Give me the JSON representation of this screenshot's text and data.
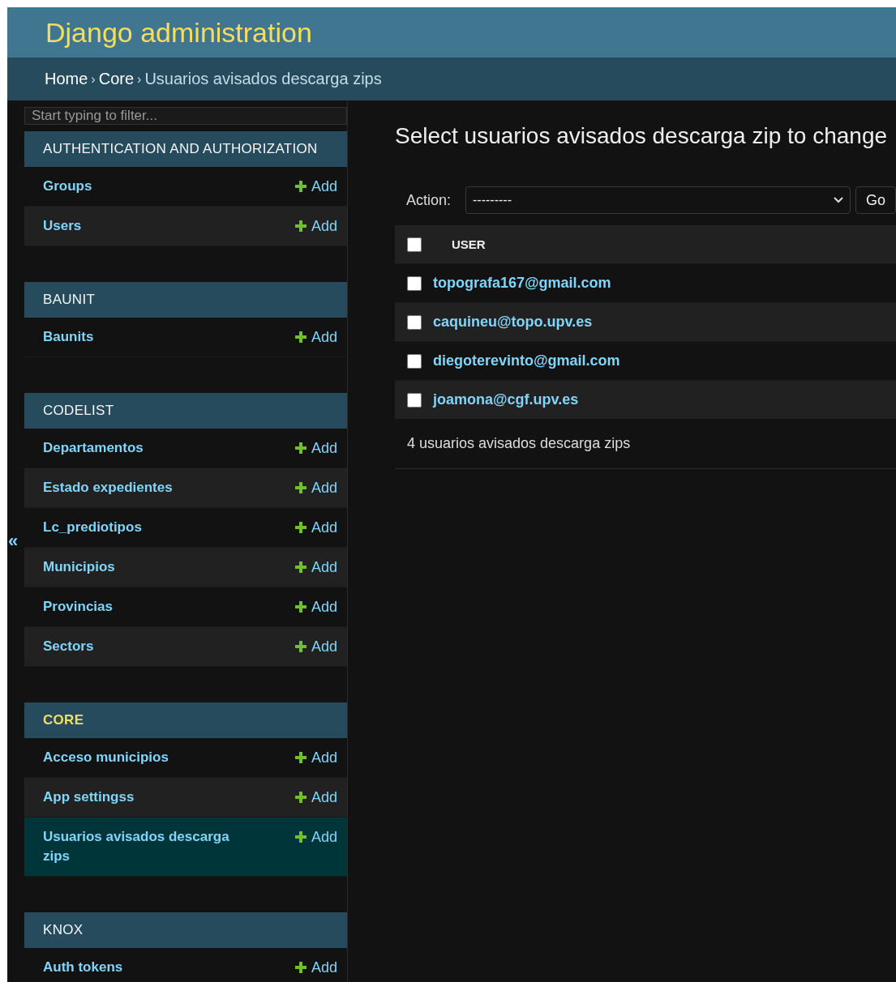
{
  "header": {
    "title": "Django administration"
  },
  "breadcrumbs": [
    {
      "label": "Home",
      "link": true
    },
    {
      "label": "Core",
      "link": true
    },
    {
      "label": "Usuarios avisados descarga zips",
      "link": false
    }
  ],
  "breadcrumb_separator": "›",
  "sidebar": {
    "filter": {
      "placeholder": "Start typing to filter..."
    },
    "toggle": "«",
    "modules": [
      {
        "name": "AUTHENTICATION AND AUTHORIZATION",
        "current": false,
        "models": [
          {
            "name": "Groups",
            "add": "Add",
            "selected": false
          },
          {
            "name": "Users",
            "add": "Add",
            "selected": false
          }
        ]
      },
      {
        "name": "BAUNIT",
        "current": false,
        "models": [
          {
            "name": "Baunits",
            "add": "Add",
            "selected": false
          }
        ]
      },
      {
        "name": "CODELIST",
        "current": false,
        "models": [
          {
            "name": "Departamentos",
            "add": "Add",
            "selected": false
          },
          {
            "name": "Estado expedientes",
            "add": "Add",
            "selected": false
          },
          {
            "name": "Lc_prediotipos",
            "add": "Add",
            "selected": false
          },
          {
            "name": "Municipios",
            "add": "Add",
            "selected": false
          },
          {
            "name": "Provincias",
            "add": "Add",
            "selected": false
          },
          {
            "name": "Sectors",
            "add": "Add",
            "selected": false
          }
        ]
      },
      {
        "name": "CORE",
        "current": true,
        "models": [
          {
            "name": "Acceso municipios",
            "add": "Add",
            "selected": false
          },
          {
            "name": "App settingss",
            "add": "Add",
            "selected": false
          },
          {
            "name": "Usuarios avisados descarga zips",
            "add": "Add",
            "selected": true
          }
        ]
      },
      {
        "name": "KNOX",
        "current": false,
        "models": [
          {
            "name": "Auth tokens",
            "add": "Add",
            "selected": false
          }
        ]
      }
    ]
  },
  "content": {
    "title": "Select usuarios avisados descarga zip to change",
    "action": {
      "label": "Action:",
      "value": "---------",
      "go": "Go"
    },
    "table": {
      "select_all_checked": false,
      "columns": [
        "USER"
      ],
      "rows": [
        {
          "user": "topografa167@gmail.com",
          "checked": false
        },
        {
          "user": "caquineu@topo.upv.es",
          "checked": false
        },
        {
          "user": "diegoterevinto@gmail.com",
          "checked": false
        },
        {
          "user": "joamona@cgf.upv.es",
          "checked": false
        }
      ]
    },
    "paginator": "4 usuarios avisados descarga zips"
  }
}
